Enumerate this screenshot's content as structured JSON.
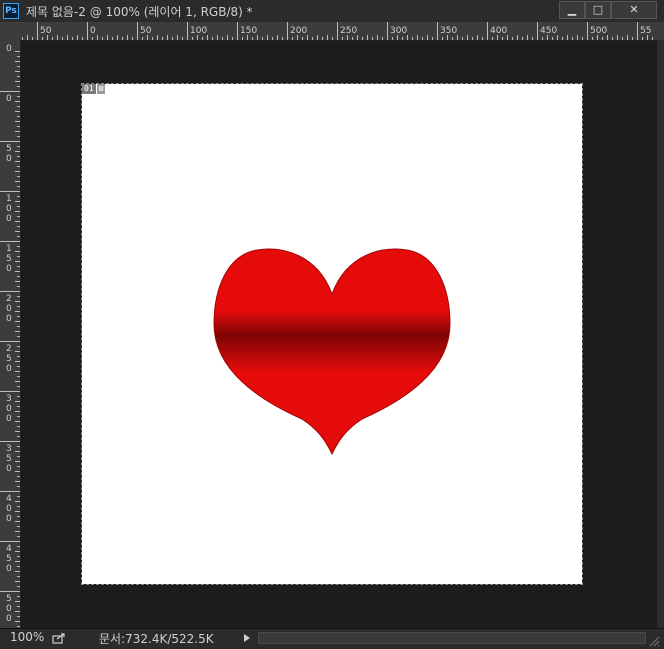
{
  "window": {
    "app_icon_label": "Ps",
    "title": "제목 없음-2 @ 100% (레이어 1, RGB/8) *",
    "minimize_glyph": "▁",
    "maximize_glyph": "□",
    "close_glyph": "✕"
  },
  "ruler": {
    "h_labels": [
      "50",
      "0",
      "50",
      "100",
      "150",
      "200",
      "250",
      "300",
      "350",
      "400",
      "450",
      "500",
      "55"
    ],
    "v_labels": [
      "0",
      "0",
      "50",
      "100",
      "150",
      "200",
      "250",
      "300",
      "350",
      "400",
      "450",
      "500"
    ]
  },
  "canvas": {
    "layer_tag": "01",
    "layer_icon_glyph": "⊠",
    "heart_colors": {
      "light": "#e60b0b",
      "dark": "#7d0404",
      "outline": "#a30606"
    }
  },
  "status": {
    "zoom": "100%",
    "doc_info": "문서:732.4K/522.5K"
  },
  "colors": {
    "chrome": "#2b2b2b",
    "ruler": "#3c3c3c",
    "workspace": "#1c1c1c",
    "accent": "#3ba0f0"
  }
}
